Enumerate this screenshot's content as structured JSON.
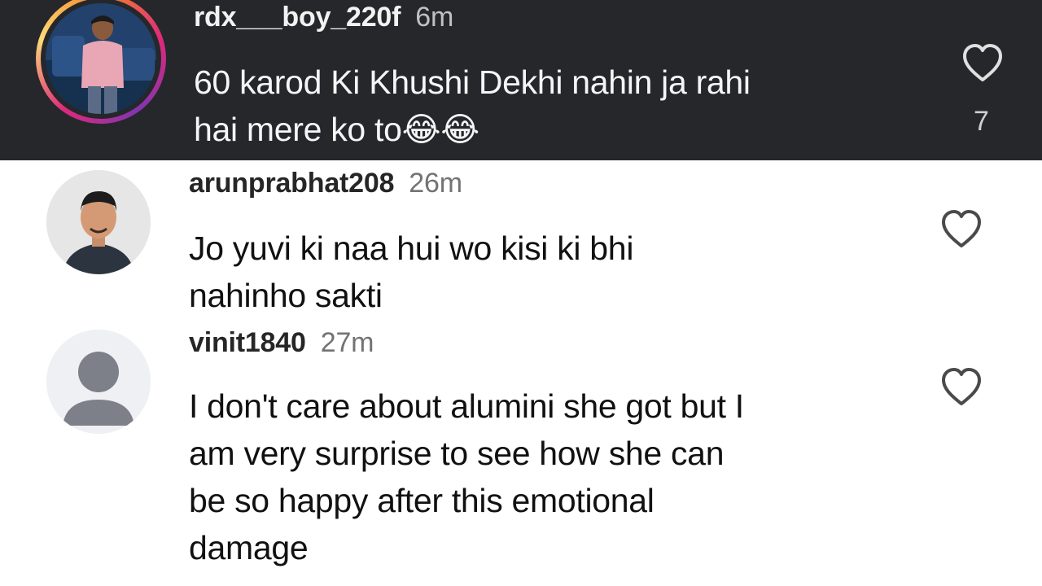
{
  "comments": [
    {
      "username": "rdx___boy_220f",
      "time": "6m",
      "text_line1": "60 karod Ki Khushi Dekhi nahin ja rahi",
      "text_line2": "hai mere ko to",
      "emoji": "😂😂",
      "likes": "7",
      "avatar": "user-photo-avatar-with-story-ring"
    },
    {
      "username": "arunprabhat208",
      "time": "26m",
      "text_line1": "Jo yuvi ki naa hui wo kisi ki bhi",
      "text_line2": "nahinho sakti",
      "avatar": "user-photo-avatar"
    },
    {
      "username": "vinit1840",
      "time": "27m",
      "text_line1": "I don't care about alumini she got but I",
      "text_line2": "am very surprise to see how she can",
      "text_line3": "be so happy after this emotional",
      "text_line4": "damage",
      "avatar": "default-person-avatar"
    }
  ],
  "colors": {
    "highlight_bg": "#25272b",
    "light_bg": "#ffffff",
    "story_ring": "#dd2a7b",
    "heart_dark": "#e0e0e0",
    "heart_light": "#4a4a4a"
  },
  "icons": {
    "like": "heart-outline-icon",
    "avatar_default": "person-silhouette-icon"
  }
}
